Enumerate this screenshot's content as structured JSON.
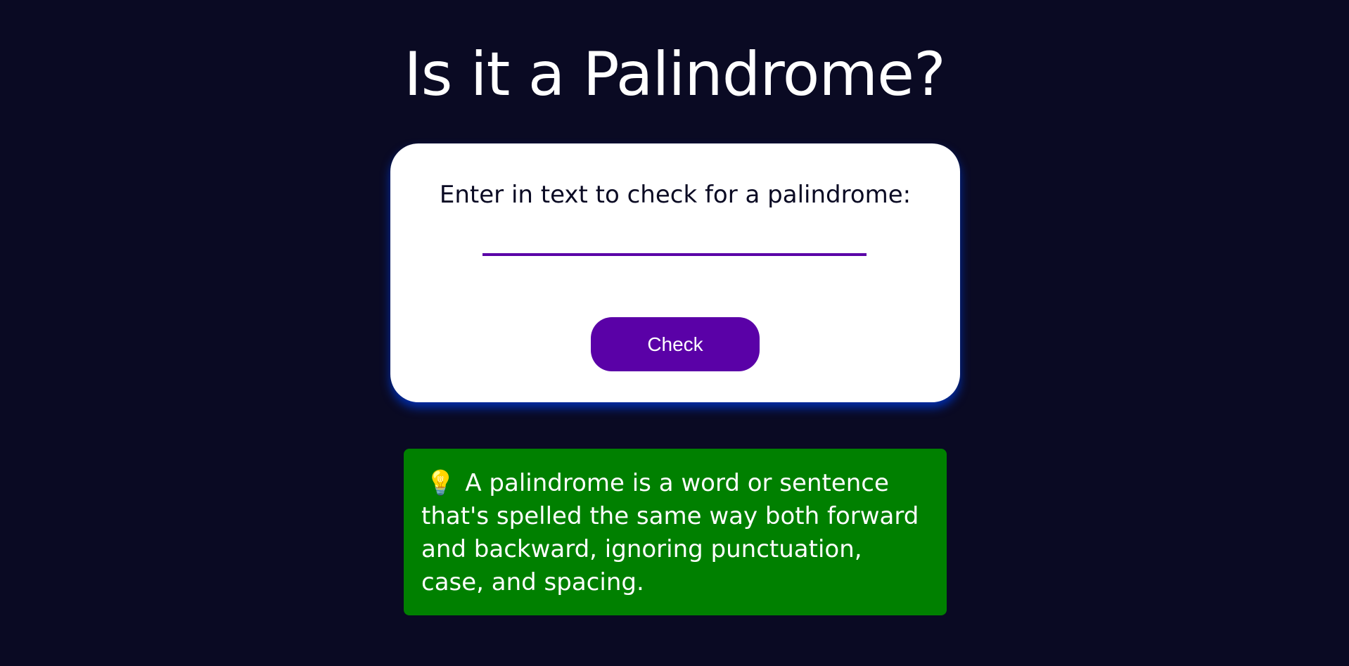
{
  "page": {
    "title": "Is it a Palindrome?"
  },
  "card": {
    "label": "Enter in text to check for a palindrome:",
    "input_value": "",
    "button_label": "Check"
  },
  "info": {
    "icon": "💡",
    "text": "A palindrome is a word or sentence that's spelled the same way both forward and backward, ignoring punctuation, case, and spacing."
  },
  "colors": {
    "background": "#0a0a23",
    "card": "#ffffff",
    "accent": "#5a01a7",
    "card_shadow": "#002ead",
    "info_background": "#008000"
  }
}
